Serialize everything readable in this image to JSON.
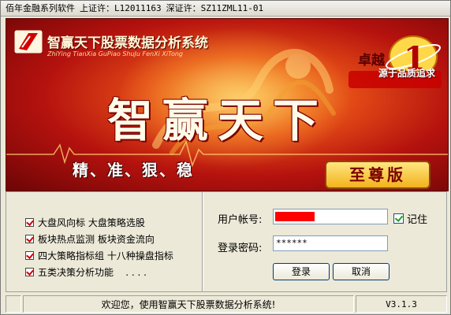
{
  "window": {
    "title_vendor": "佰年金融系列软件",
    "title_sh_label": "上证许：",
    "title_sh_value": "L12011163",
    "title_sz_label": "深证许：",
    "title_sz_value": "SZ11ZML11-01"
  },
  "banner": {
    "app_name": "智赢天下股票数据分析系统",
    "app_pinyin": "ZhiYing TianXia GuPiao ShuJu FenXi XiTong",
    "slogan_main": "卓越",
    "slogan_sub": "源于品质追求",
    "big_title": "智赢天下",
    "tagline": "精、准、狠、稳",
    "edition": "至尊版"
  },
  "features": [
    "大盘风向标 大盘策略选股",
    "板块热点监测 板块资金流向",
    "四大策略指标组 十八种操盘指标",
    "五类决策分析功能    . . . ."
  ],
  "login": {
    "account_label": "用户帐号:",
    "account_value": "",
    "password_label": "登录密码:",
    "password_value": "******",
    "remember_label": "记住",
    "remember_checked": true,
    "login_button": "登录",
    "cancel_button": "取消"
  },
  "status": {
    "welcome": "欢迎您，使用智赢天下股票数据分析系统!",
    "version": "V3.1.3"
  },
  "colors": {
    "banner_red": "#b5120e",
    "check_red": "#d00000",
    "account_redaction": "#ff0000"
  }
}
